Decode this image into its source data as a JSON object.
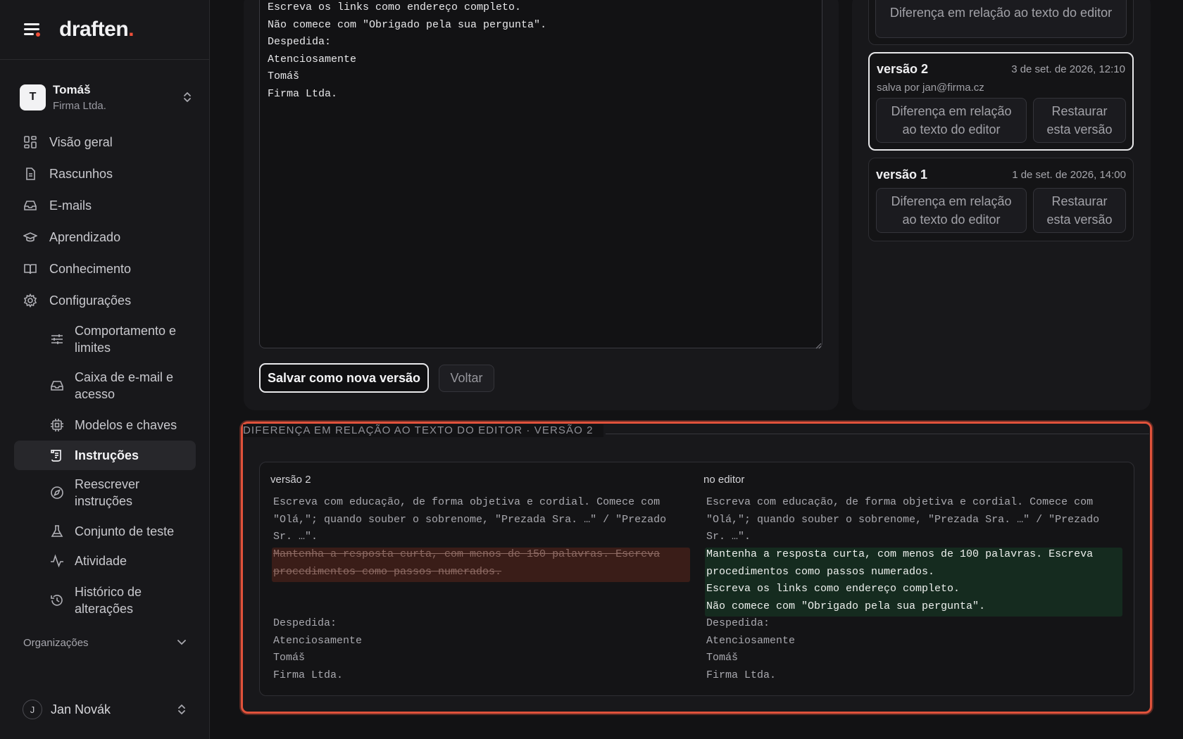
{
  "brand": {
    "logo_text": "draften",
    "logo_dot": ".",
    "menu_icon": "menu-icon",
    "accent_color": "#ef4f3a"
  },
  "account": {
    "initial": "T",
    "name": "Tomáš",
    "org": "Firma Ltda.",
    "icon": "chevrons-up-down-icon"
  },
  "nav": {
    "items": [
      {
        "label": "Visão geral",
        "icon": "grid-icon"
      },
      {
        "label": "Rascunhos",
        "icon": "file-text-icon"
      },
      {
        "label": "E-mails",
        "icon": "inbox-icon"
      },
      {
        "label": "Aprendizado",
        "icon": "graduation-cap-icon"
      },
      {
        "label": "Conhecimento",
        "icon": "book-open-icon"
      },
      {
        "label": "Configurações",
        "icon": "gear-icon"
      }
    ],
    "sub_items": [
      {
        "label": "Comportamento e limites",
        "icon": "sliders-icon"
      },
      {
        "label": "Caixa de e-mail e acesso",
        "icon": "inbox-icon"
      },
      {
        "label": "Modelos e chaves",
        "icon": "cpu-icon"
      },
      {
        "label": "Instruções",
        "icon": "scroll-icon",
        "active": true
      },
      {
        "label": "Reescrever instruções",
        "icon": "compass-icon"
      },
      {
        "label": "Conjunto de teste",
        "icon": "flask-icon"
      },
      {
        "label": "Atividade",
        "icon": "activity-icon"
      },
      {
        "label": "Histórico de alterações",
        "icon": "history-icon"
      }
    ],
    "organizations_label": "Organizações"
  },
  "user": {
    "initial": "J",
    "name": "Jan Novák"
  },
  "editor": {
    "lines": [
      "Escreva os links como endereço completo.",
      "Não comece com \"Obrigado pela sua pergunta\".",
      "Despedida:",
      "Atenciosamente",
      "Tomáš",
      "Firma Ltda."
    ],
    "save_label": "Salvar como nova versão",
    "back_label": "Voltar"
  },
  "versions": {
    "top_partial_button": "Diferença em relação ao texto do editor",
    "items": [
      {
        "title": "versão 2",
        "date": "3 de set. de 2026, 12:10",
        "saved_by": "salva por jan@firma.cz",
        "diff_button": "Diferença em relação ao texto do editor",
        "restore_button": "Restaurar esta versão"
      },
      {
        "title": "versão 1",
        "date": "1 de set. de 2026, 14:00",
        "diff_button": "Diferença em relação ao texto do editor",
        "restore_button": "Restaurar esta versão"
      }
    ]
  },
  "diff": {
    "heading": "DIFERENÇA EM RELAÇÃO AO TEXTO DO EDITOR · VERSÃO 2",
    "left_label": "versão 2",
    "right_label": "no editor",
    "common_top": [
      "Escreva com educação, de forma objetiva e cordial. Comece com",
      "\"Olá,\"; quando souber o sobrenome, \"Prezada Sra. …\" / \"Prezado",
      "Sr. …\"."
    ],
    "removed": [
      "Mantenha a resposta curta, com menos de 150 palavras. Escreva",
      "procedimentos como passos numerados."
    ],
    "added": [
      "Mantenha a resposta curta, com menos de 100 palavras. Escreva",
      "procedimentos como passos numerados.",
      "Escreva os links como endereço completo.",
      "Não comece com \"Obrigado pela sua pergunta\"."
    ],
    "common_bottom": [
      "Despedida:",
      "Atenciosamente",
      "Tomáš",
      "Firma Ltda."
    ],
    "colors": {
      "removed_bg": "#3a1d18",
      "added_bg": "#152b1f",
      "highlight_border": "#e0523b"
    }
  }
}
